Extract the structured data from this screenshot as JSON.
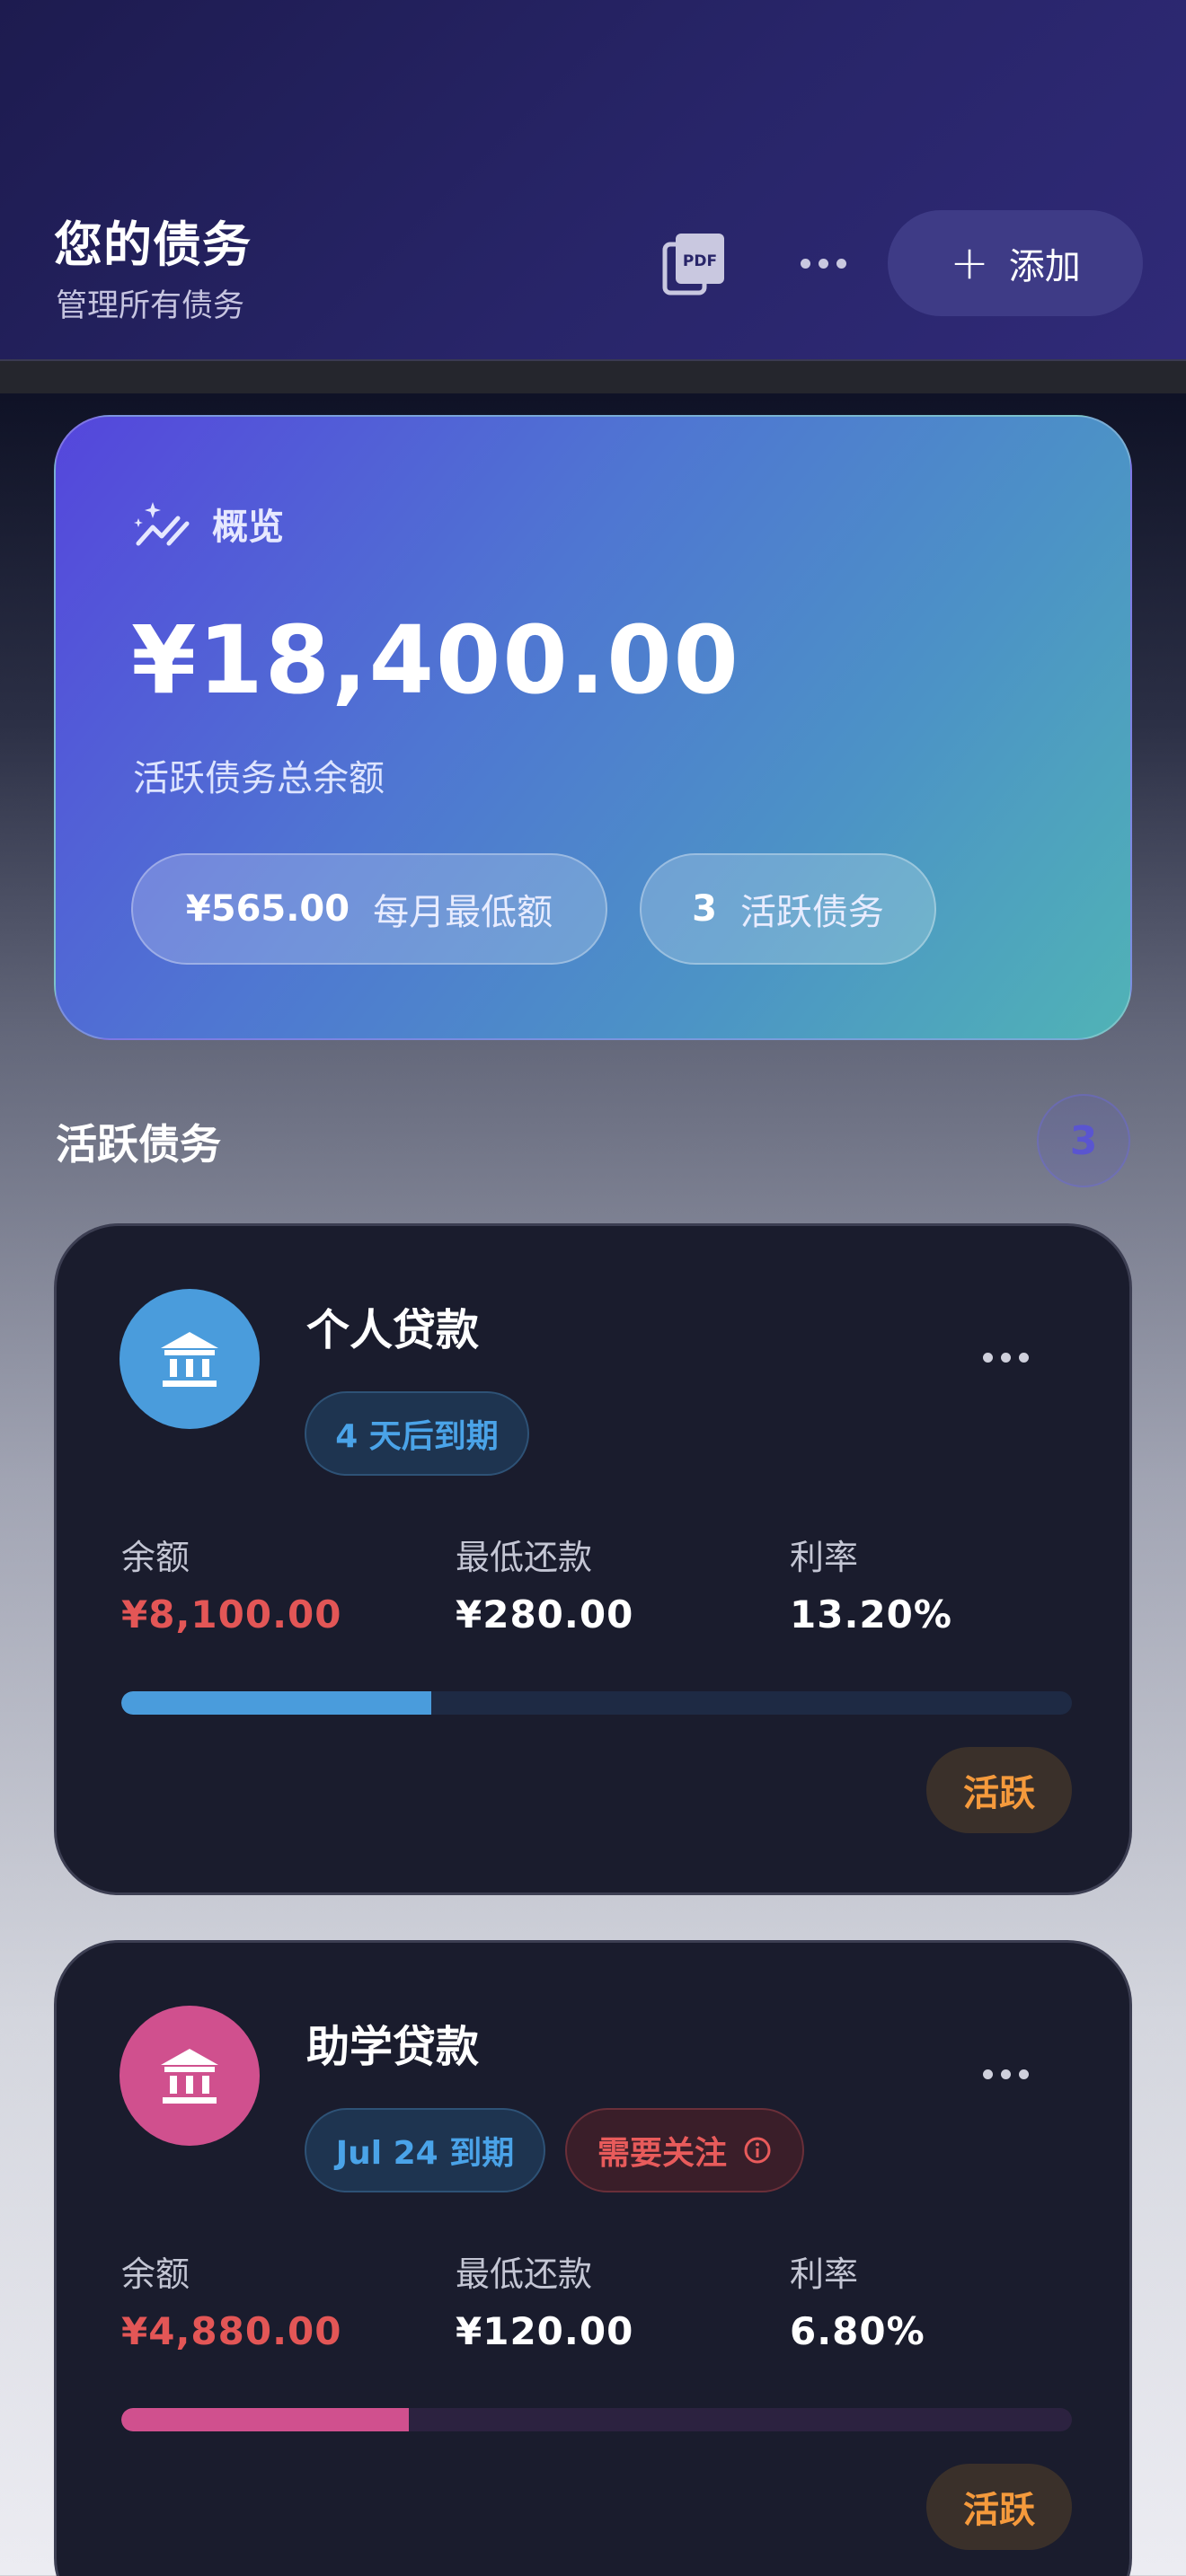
{
  "header": {
    "title": "您的债务",
    "subtitle": "管理所有债务",
    "pdf_icon": "pdf-icon",
    "more_icon": "more-horizontal-icon",
    "add_label": "添加"
  },
  "overview": {
    "label": "概览",
    "total_balance": "¥18,400.00",
    "description": "活跃债务总余额",
    "monthly_min_value": "¥565.00",
    "monthly_min_label": "每月最低额",
    "active_count_value": "3",
    "active_count_label": "活跃债务"
  },
  "section": {
    "title": "活跃债务",
    "count": "3"
  },
  "debts": [
    {
      "name": "个人贷款",
      "icon": "bank-icon",
      "icon_color": "#4a9cdc",
      "due_badge": "4 天后到期",
      "attention_badge": "",
      "balance_label": "余额",
      "balance": "¥8,100.00",
      "min_payment_label": "最低还款",
      "min_payment": "¥280.00",
      "rate_label": "利率",
      "rate": "13.20%",
      "progress": 0.326,
      "progress_color": "#4a9cdc",
      "track_color": "#1e2a44",
      "status": "活跃"
    },
    {
      "name": "助学贷款",
      "icon": "bank-icon",
      "icon_color": "#d0508e",
      "due_badge": "Jul 24 到期",
      "attention_badge": "需要关注",
      "balance_label": "余额",
      "balance": "¥4,880.00",
      "min_payment_label": "最低还款",
      "min_payment": "¥120.00",
      "rate_label": "利率",
      "rate": "6.80%",
      "progress": 0.302,
      "progress_color": "#d0508e",
      "track_color": "#2c2240",
      "status": "活跃"
    }
  ],
  "colors": {
    "header_bg": "#282569",
    "accent_red": "#e35656",
    "status_orange": "#f59a3c"
  }
}
